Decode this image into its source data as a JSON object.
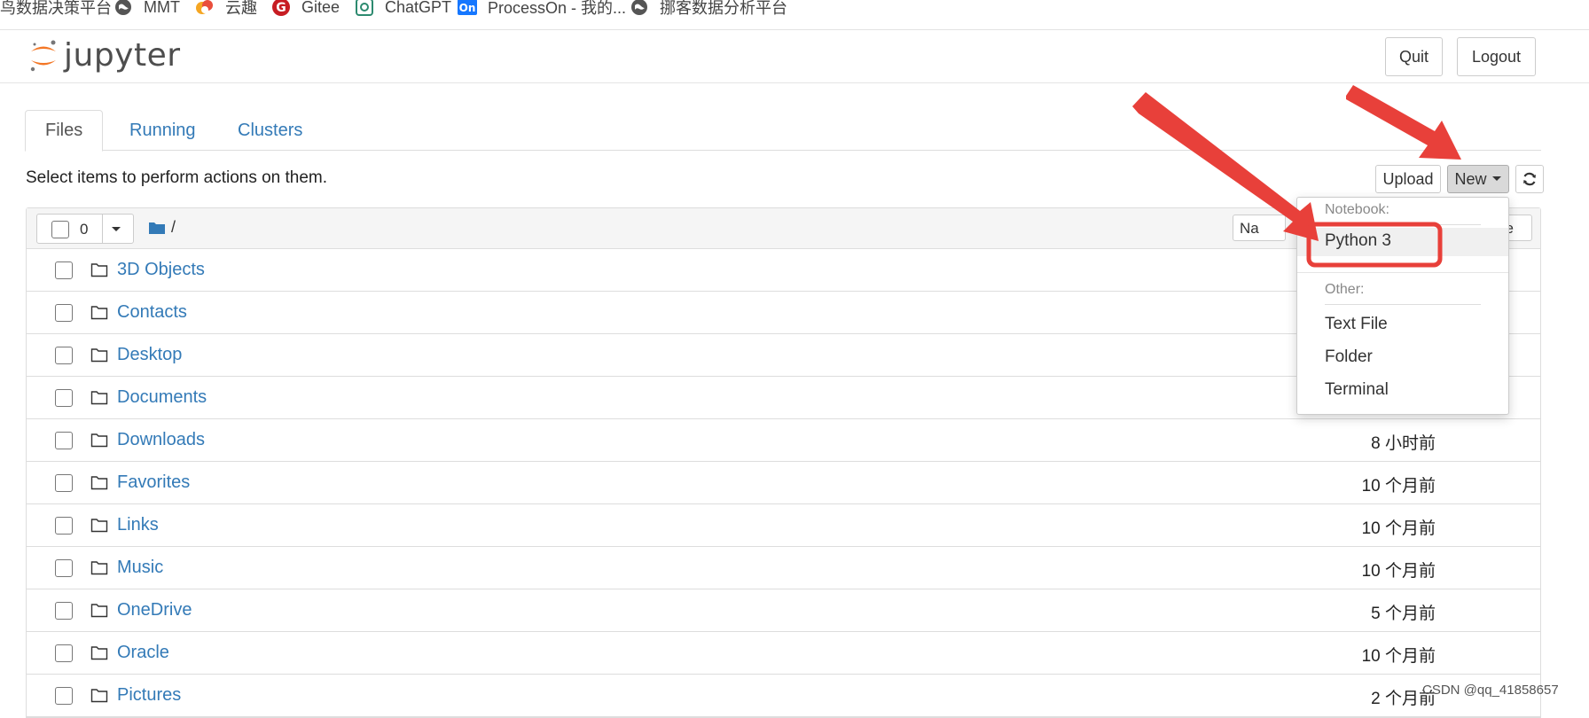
{
  "bookmarks": [
    {
      "label": "鸟数据决策平台",
      "icon": "none"
    },
    {
      "label": "MMT",
      "icon": "globe-icon"
    },
    {
      "label": "云趣",
      "icon": "cloud-logo-icon"
    },
    {
      "label": "Gitee",
      "icon": "gitee-logo-icon"
    },
    {
      "label": "ChatGPT",
      "icon": "chatgpt-logo-icon"
    },
    {
      "label": "ProcessOn - 我的...",
      "icon": "processon-logo-icon"
    },
    {
      "label": "挪客数据分析平台",
      "icon": "globe-icon"
    }
  ],
  "header": {
    "logo_text": "jupyter",
    "quit_label": "Quit",
    "logout_label": "Logout"
  },
  "tabs": [
    {
      "label": "Files",
      "active": true
    },
    {
      "label": "Running",
      "active": false
    },
    {
      "label": "Clusters",
      "active": false
    }
  ],
  "toolbar": {
    "hint": "Select items to perform actions on them.",
    "upload_label": "Upload",
    "new_label": "New",
    "refresh_icon": "refresh-icon"
  },
  "list_header": {
    "selected_count": "0",
    "path": "/",
    "name_sort_partial": "Na",
    "size_partial": "ze"
  },
  "files": [
    {
      "name": "3D Objects",
      "modified": ""
    },
    {
      "name": "Contacts",
      "modified": ""
    },
    {
      "name": "Desktop",
      "modified": ""
    },
    {
      "name": "Documents",
      "modified": ""
    },
    {
      "name": "Downloads",
      "modified": "8 小时前"
    },
    {
      "name": "Favorites",
      "modified": "10 个月前"
    },
    {
      "name": "Links",
      "modified": "10 个月前"
    },
    {
      "name": "Music",
      "modified": "10 个月前"
    },
    {
      "name": "OneDrive",
      "modified": "5 个月前"
    },
    {
      "name": "Oracle",
      "modified": "10 个月前"
    },
    {
      "name": "Pictures",
      "modified": "2 个月前"
    }
  ],
  "new_menu": {
    "notebook_header": "Notebook:",
    "python3": "Python 3",
    "other_header": "Other:",
    "text_file": "Text File",
    "folder": "Folder",
    "terminal": "Terminal"
  },
  "colors": {
    "link": "#337ab7",
    "annotation_red": "#e8403a"
  },
  "watermark": "CSDN @qq_41858657"
}
